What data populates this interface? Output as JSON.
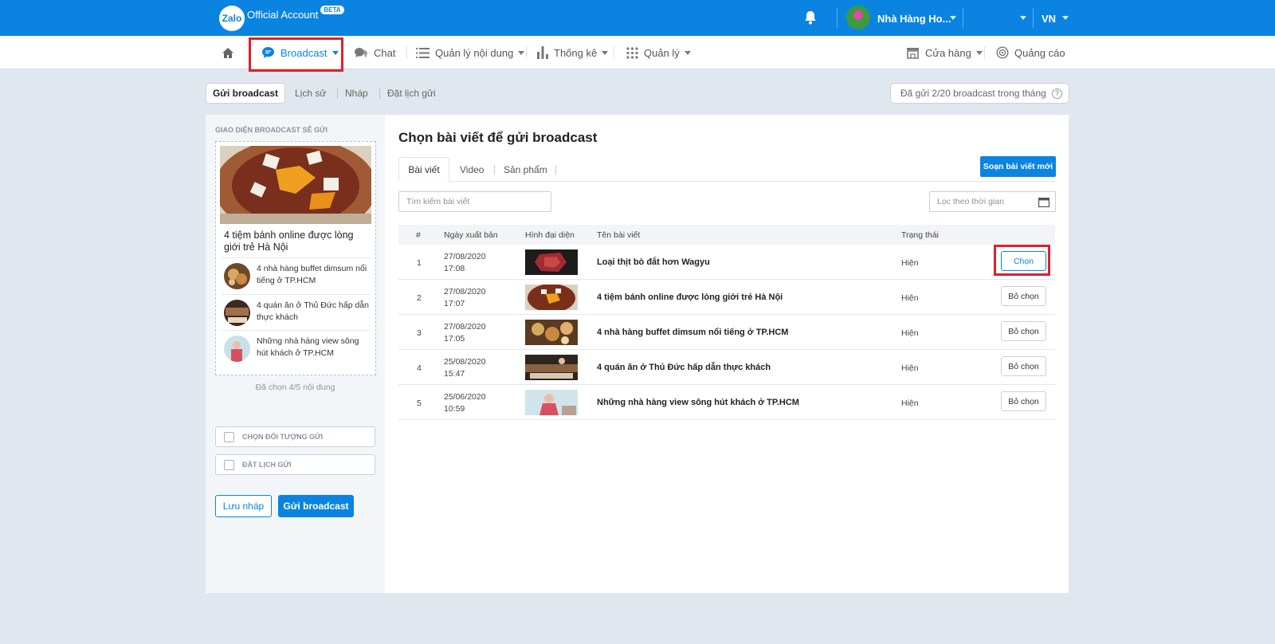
{
  "header": {
    "logo_mark": "Zalo",
    "logo_text": "Official Account",
    "beta": "BETA",
    "shop_name": "Nhà Hàng Ho...",
    "language": "VN"
  },
  "nav": {
    "broadcast": "Broadcast",
    "chat": "Chat",
    "content": "Quản lý nội dung",
    "stats": "Thống kê",
    "manage": "Quản lý",
    "store": "Cửa hàng",
    "ads": "Quảng cáo"
  },
  "subtabs": {
    "send": "Gửi broadcast",
    "history": "Lịch sử",
    "draft": "Nháp",
    "schedule": "Đặt lịch gửi"
  },
  "quota": "Đã gửi 2/20 broadcast trong tháng",
  "preview": {
    "title": "GIAO DIỆN BROADCAST SẼ GỬI",
    "headline": "4 tiệm bánh online được lòng giới trẻ Hà Nội",
    "items": [
      {
        "text": "4 nhà hàng buffet dimsum nổi tiếng ở TP.HCM"
      },
      {
        "text": "4 quán ăn ở Thủ Đức hấp dẫn thực khách"
      },
      {
        "text": "Những nhà hàng view sông hút khách ở TP.HCM"
      }
    ],
    "chosen_count": "Đã chọn 4/5 nội dung"
  },
  "options": {
    "audience": "CHỌN ĐỐI TƯỢNG GỬI",
    "schedule": "ĐẶT LỊCH GỬI"
  },
  "actions": {
    "save_draft": "Lưu nháp",
    "send": "Gửi broadcast"
  },
  "main": {
    "title": "Chọn bài viết để gửi broadcast",
    "tabs": [
      "Bài viết",
      "Video",
      "Sản phẩm"
    ],
    "new_post": "Soạn bài viết mới",
    "search_placeholder": "Tìm kiếm bài viết",
    "date_filter": "Lọc theo thời gian"
  },
  "table": {
    "headers": [
      "#",
      "Ngày xuất bản",
      "Hình đại diện",
      "Tên bài viết",
      "Trạng thái"
    ],
    "rows": [
      {
        "num": "1",
        "date": "27/08/2020",
        "time": "17:08",
        "title": "Loại thịt bò đắt hơn Wagyu",
        "status": "Hiện",
        "action": "Chọn"
      },
      {
        "num": "2",
        "date": "27/08/2020",
        "time": "17:07",
        "title": "4 tiệm bánh online được lòng giới trẻ Hà Nội",
        "status": "Hiện",
        "action": "Bỏ chọn"
      },
      {
        "num": "3",
        "date": "27/08/2020",
        "time": "17:05",
        "title": "4 nhà hàng buffet dimsum nổi tiếng ở TP.HCM",
        "status": "Hiện",
        "action": "Bỏ chọn"
      },
      {
        "num": "4",
        "date": "25/08/2020",
        "time": "15:47",
        "title": "4 quán ăn ở Thủ Đức hấp dẫn thực khách",
        "status": "Hiện",
        "action": "Bỏ chọn"
      },
      {
        "num": "5",
        "date": "25/06/2020",
        "time": "10:59",
        "title": "Những nhà hàng view sông hút khách ở TP.HCM",
        "status": "Hiện",
        "action": "Bỏ chọn"
      }
    ]
  },
  "colors": {
    "brand": "#0a84e0",
    "highlight": "#e0202a",
    "background": "#e1e7ee"
  }
}
